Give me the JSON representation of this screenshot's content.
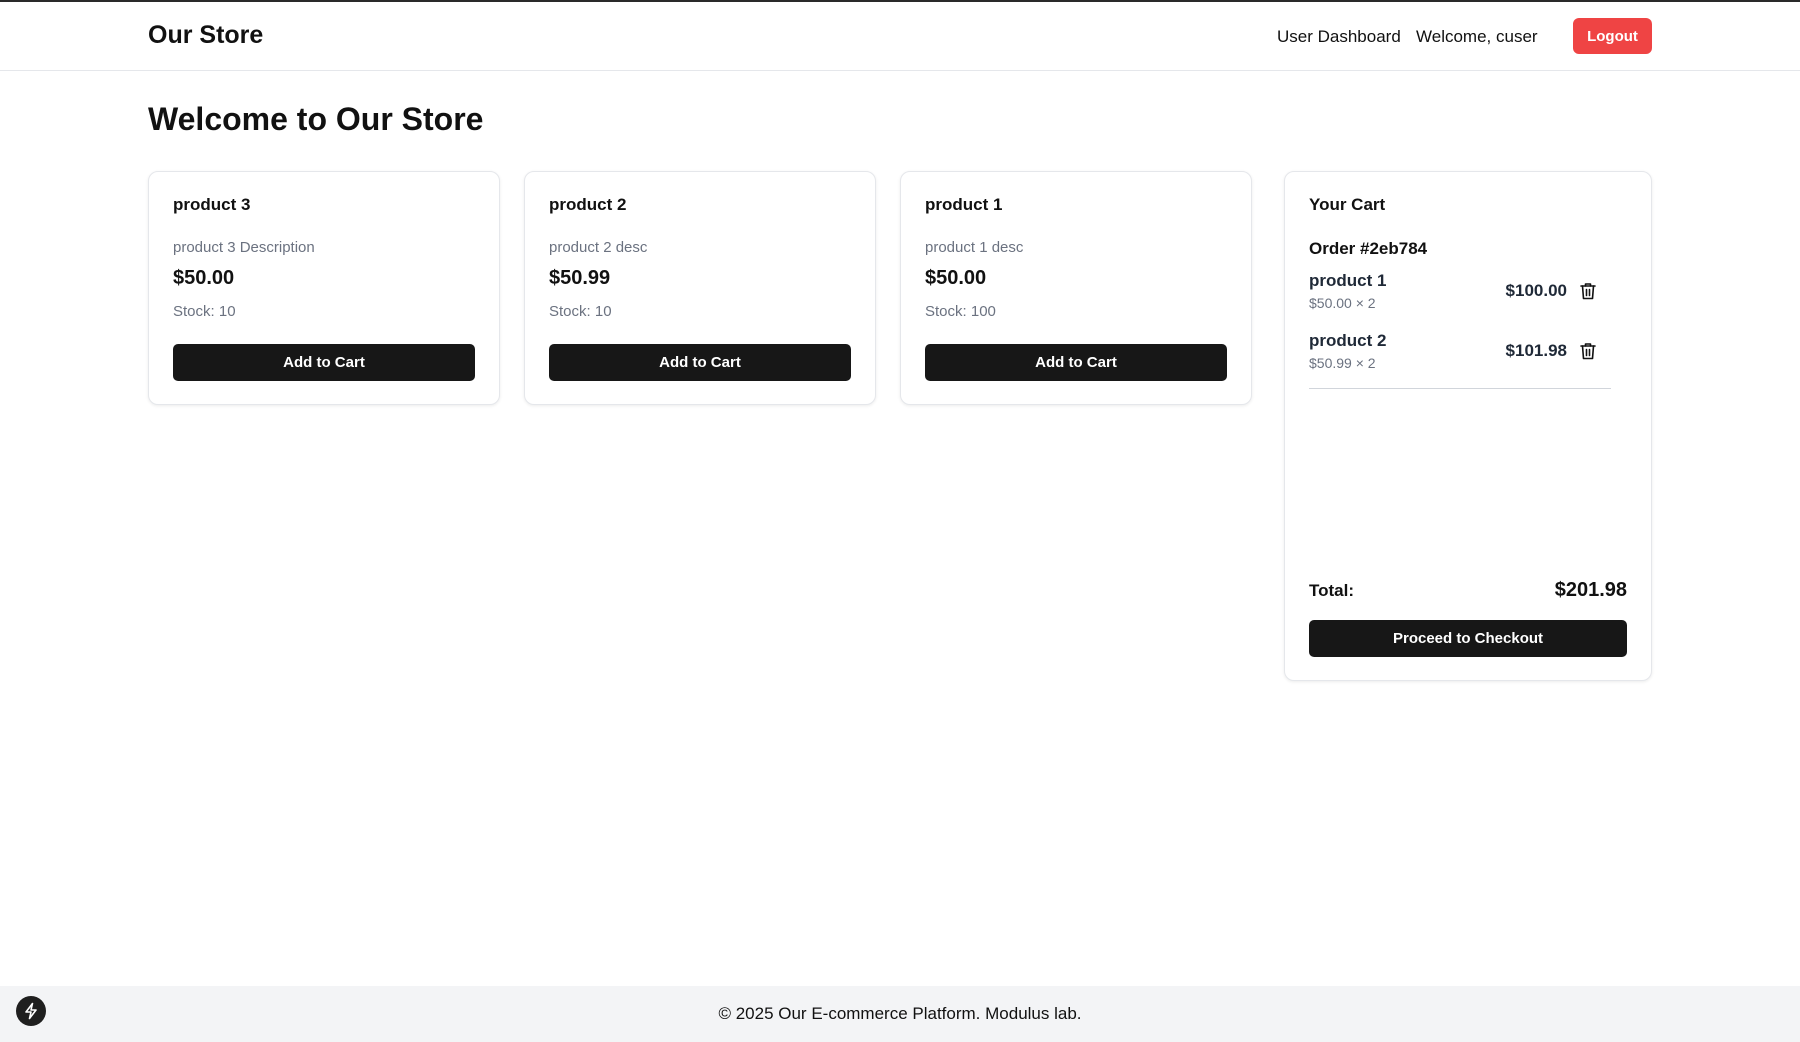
{
  "header": {
    "brand": "Our Store",
    "nav_link": "User Dashboard",
    "welcome": "Welcome, cuser",
    "logout_label": "Logout"
  },
  "main": {
    "title": "Welcome to Our Store",
    "products": [
      {
        "name": "product 3",
        "description": "product 3 Description",
        "price": "$50.00",
        "stock": "Stock: 10",
        "button_label": "Add to Cart"
      },
      {
        "name": "product 2",
        "description": "product 2 desc",
        "price": "$50.99",
        "stock": "Stock: 10",
        "button_label": "Add to Cart"
      },
      {
        "name": "product 1",
        "description": "product 1 desc",
        "price": "$50.00",
        "stock": "Stock: 100",
        "button_label": "Add to Cart"
      }
    ]
  },
  "cart": {
    "title": "Your Cart",
    "order_id": "Order #2eb784",
    "items": [
      {
        "name": "product 1",
        "unit_qty": "$50.00 × 2",
        "line_total": "$100.00",
        "icon": "trash-icon"
      },
      {
        "name": "product 2",
        "unit_qty": "$50.99 × 2",
        "line_total": "$101.98",
        "icon": "trash-icon"
      }
    ],
    "total_label": "Total:",
    "total_value": "$201.98",
    "checkout_label": "Proceed to Checkout"
  },
  "footer": {
    "text": "© 2025 Our E-commerce Platform. Modulus lab.",
    "badge_icon": "lightning-icon"
  },
  "colors": {
    "logout": "#ef4444",
    "primary_button": "#171717",
    "footer_bg": "#f3f4f6",
    "muted_text": "#6b7280"
  }
}
